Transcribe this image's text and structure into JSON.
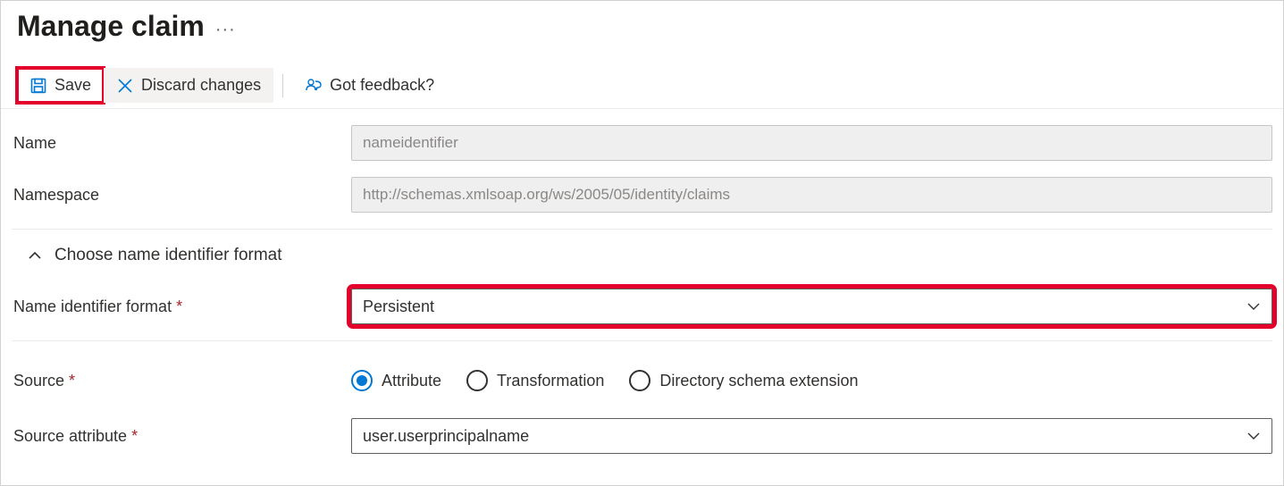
{
  "header": {
    "title": "Manage claim"
  },
  "toolbar": {
    "save_label": "Save",
    "discard_label": "Discard changes",
    "feedback_label": "Got feedback?"
  },
  "fields": {
    "name": {
      "label": "Name",
      "value": "nameidentifier"
    },
    "namespace": {
      "label": "Namespace",
      "value": "http://schemas.xmlsoap.org/ws/2005/05/identity/claims"
    },
    "expander_label": "Choose name identifier format",
    "name_id_format": {
      "label": "Name identifier format",
      "value": "Persistent"
    },
    "source": {
      "label": "Source",
      "options": {
        "attribute": "Attribute",
        "transformation": "Transformation",
        "directory_ext": "Directory schema extension"
      },
      "selected": "attribute"
    },
    "source_attribute": {
      "label": "Source attribute",
      "value": "user.userprincipalname"
    }
  }
}
